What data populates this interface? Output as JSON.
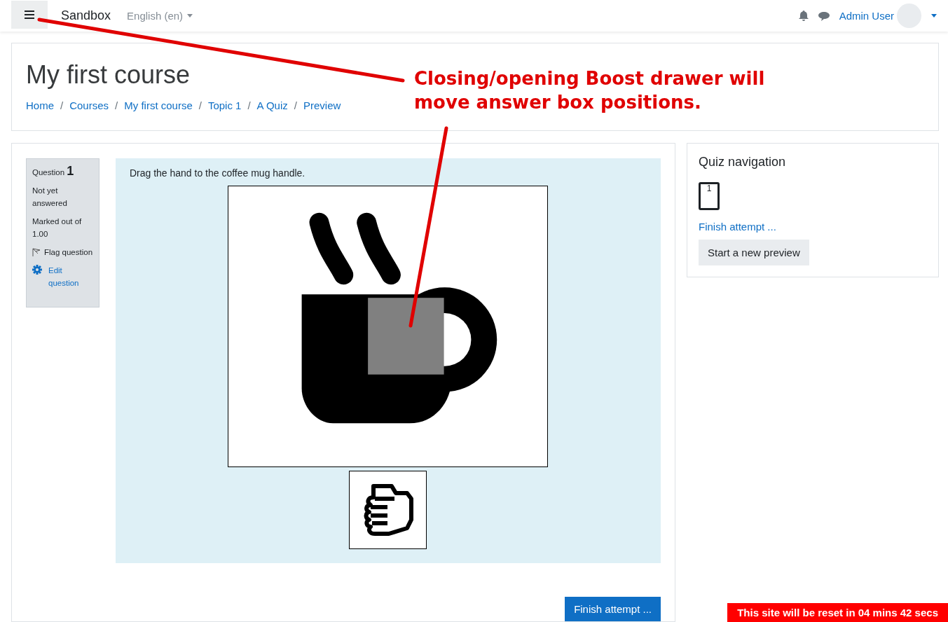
{
  "navbar": {
    "site_name": "Sandbox",
    "language": "English (en)",
    "user_name": "Admin User"
  },
  "header": {
    "title": "My first course",
    "breadcrumb": [
      "Home",
      "Courses",
      "My first course",
      "Topic 1",
      "A Quiz",
      "Preview"
    ],
    "separator": "/"
  },
  "question_info": {
    "label": "Question",
    "number": "1",
    "status": "Not yet answered",
    "marks": "Marked out of 1.00",
    "flag": "Flag question",
    "edit": "Edit question"
  },
  "question": {
    "text": "Drag the hand to the coffee mug handle."
  },
  "finish_button": "Finish attempt ...",
  "quiz_navigation": {
    "title": "Quiz navigation",
    "questions": [
      {
        "label": "1"
      }
    ],
    "finish_link": "Finish attempt ...",
    "new_preview_button": "Start a new preview"
  },
  "annotation": {
    "text": "Closing/opening Boost drawer will move answer box positions."
  },
  "reset_banner": "This site will be reset in 04 mins 42 secs"
}
